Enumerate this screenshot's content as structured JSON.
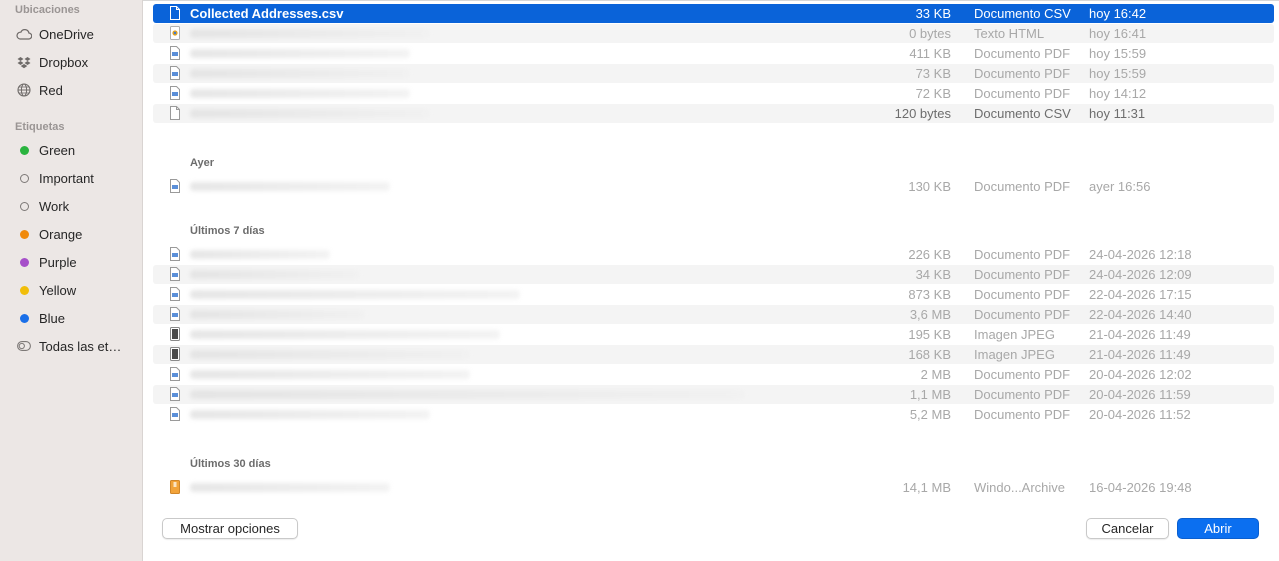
{
  "sidebar": {
    "locations_header": "Ubicaciones",
    "locations": [
      {
        "label": "OneDrive",
        "icon": "cloud-icon"
      },
      {
        "label": "Dropbox",
        "icon": "dropbox-icon"
      },
      {
        "label": "Red",
        "icon": "globe-icon"
      }
    ],
    "tags_header": "Etiquetas",
    "tags": [
      {
        "label": "Green",
        "color": "#2ab43f"
      },
      {
        "label": "Important",
        "color": ""
      },
      {
        "label": "Work",
        "color": ""
      },
      {
        "label": "Orange",
        "color": "#f08a0c"
      },
      {
        "label": "Purple",
        "color": "#a64fc9"
      },
      {
        "label": "Yellow",
        "color": "#f1be0a"
      },
      {
        "label": "Blue",
        "color": "#1a6fe8"
      },
      {
        "label": "Todas las et…",
        "color": "all"
      }
    ]
  },
  "sections": {
    "yesterday": "Ayer",
    "last7": "Últimos 7 días",
    "last30": "Últimos 30 días"
  },
  "files_today": [
    {
      "name": "Collected Addresses.csv",
      "size": "33 KB",
      "kind": "Documento CSV",
      "date": "hoy 16:42",
      "icon": "csv-file-icon",
      "selected": true
    },
    {
      "name": "",
      "size": "0 bytes",
      "kind": "Texto HTML",
      "date": "hoy 16:41",
      "icon": "html-file-icon"
    },
    {
      "name": "",
      "size": "411 KB",
      "kind": "Documento PDF",
      "date": "hoy 15:59",
      "icon": "pdf-file-icon"
    },
    {
      "name": "",
      "size": "73 KB",
      "kind": "Documento PDF",
      "date": "hoy 15:59",
      "icon": "pdf-file-icon"
    },
    {
      "name": "",
      "size": "72 KB",
      "kind": "Documento PDF",
      "date": "hoy 14:12",
      "icon": "pdf-file-icon"
    },
    {
      "name": "",
      "size": "120 bytes",
      "kind": "Documento CSV",
      "date": "hoy 11:31",
      "icon": "csv-file-icon",
      "active": true
    }
  ],
  "files_yesterday": [
    {
      "name": "",
      "size": "130 KB",
      "kind": "Documento PDF",
      "date": "ayer 16:56",
      "icon": "pdf-file-icon"
    }
  ],
  "files_last7": [
    {
      "name": "",
      "size": "226 KB",
      "kind": "Documento PDF",
      "date": "24-04-2026 12:18",
      "icon": "pdf-file-icon"
    },
    {
      "name": "",
      "size": "34 KB",
      "kind": "Documento PDF",
      "date": "24-04-2026 12:09",
      "icon": "pdf-file-icon"
    },
    {
      "name": "",
      "size": "873 KB",
      "kind": "Documento PDF",
      "date": "22-04-2026 17:15",
      "icon": "pdf-file-icon"
    },
    {
      "name": "",
      "size": "3,6 MB",
      "kind": "Documento PDF",
      "date": "22-04-2026 14:40",
      "icon": "pdf-file-icon"
    },
    {
      "name": "",
      "size": "195 KB",
      "kind": "Imagen JPEG",
      "date": "21-04-2026 11:49",
      "icon": "jpeg-file-icon"
    },
    {
      "name": "",
      "size": "168 KB",
      "kind": "Imagen JPEG",
      "date": "21-04-2026 11:49",
      "icon": "jpeg-file-icon"
    },
    {
      "name": "",
      "size": "2 MB",
      "kind": "Documento PDF",
      "date": "20-04-2026 12:02",
      "icon": "pdf-file-icon"
    },
    {
      "name": "",
      "size": "1,1 MB",
      "kind": "Documento PDF",
      "date": "20-04-2026 11:59",
      "icon": "pdf-file-icon"
    },
    {
      "name": "",
      "size": "5,2 MB",
      "kind": "Documento PDF",
      "date": "20-04-2026 11:52",
      "icon": "pdf-file-icon"
    }
  ],
  "files_last30": [
    {
      "name": "",
      "size": "14,1 MB",
      "kind": "Windo...Archive",
      "date": "16-04-2026 19:48",
      "icon": "archive-file-icon"
    }
  ],
  "buttons": {
    "options": "Mostrar opciones",
    "cancel": "Cancelar",
    "open": "Abrir"
  },
  "colors": {
    "selection": "#0a63d9",
    "primary_button": "#0b6ff0",
    "sidebar_bg": "#ece7e5"
  }
}
